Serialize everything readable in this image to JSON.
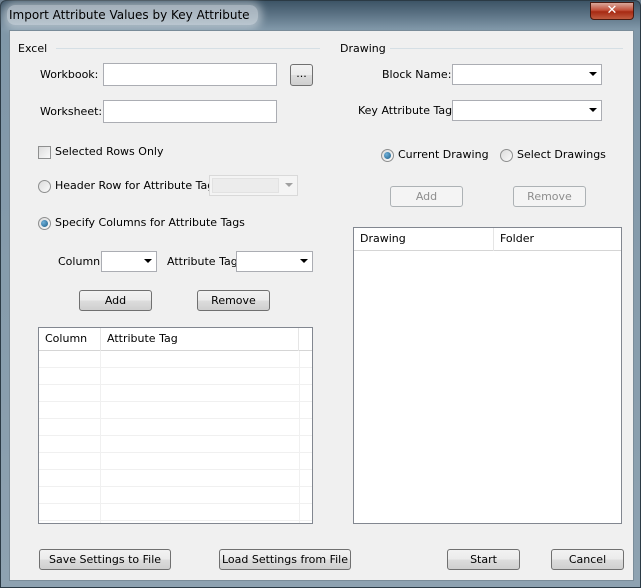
{
  "window": {
    "title": "Import Attribute Values by Key Attribute",
    "close_glyph": "✕"
  },
  "excel": {
    "group_title": "Excel",
    "workbook_label": "Workbook:",
    "workbook_value": "",
    "browse_label": "...",
    "worksheet_label": "Worksheet:",
    "worksheet_value": "",
    "selected_rows_label": "Selected Rows Only",
    "selected_rows_checked": false,
    "header_row_label": "Header Row for Attribute Tags:",
    "header_row_selected": false,
    "specify_columns_label": "Specify Columns for Attribute Tags",
    "specify_columns_selected": true,
    "column_label": "Column:",
    "attribute_tag_label": "Attribute Tag:",
    "add_label": "Add",
    "remove_label": "Remove",
    "grid_columns": [
      "Column",
      "Attribute Tag"
    ]
  },
  "drawing": {
    "group_title": "Drawing",
    "block_name_label": "Block Name:",
    "key_attribute_tag_label": "Key Attribute Tag:",
    "current_drawing_label": "Current Drawing",
    "current_drawing_selected": true,
    "select_drawings_label": "Select Drawings",
    "select_drawings_selected": false,
    "add_label": "Add",
    "remove_label": "Remove",
    "list_columns": [
      "Drawing",
      "Folder"
    ]
  },
  "footer": {
    "save_settings_label": "Save Settings to File",
    "load_settings_label": "Load Settings from File",
    "start_label": "Start",
    "cancel_label": "Cancel"
  },
  "colors": {
    "title_frame": "#8ea2b1",
    "client_background": "#f0f0f0",
    "close_button": "#c2503a",
    "radio_accent": "#1b5c86"
  }
}
